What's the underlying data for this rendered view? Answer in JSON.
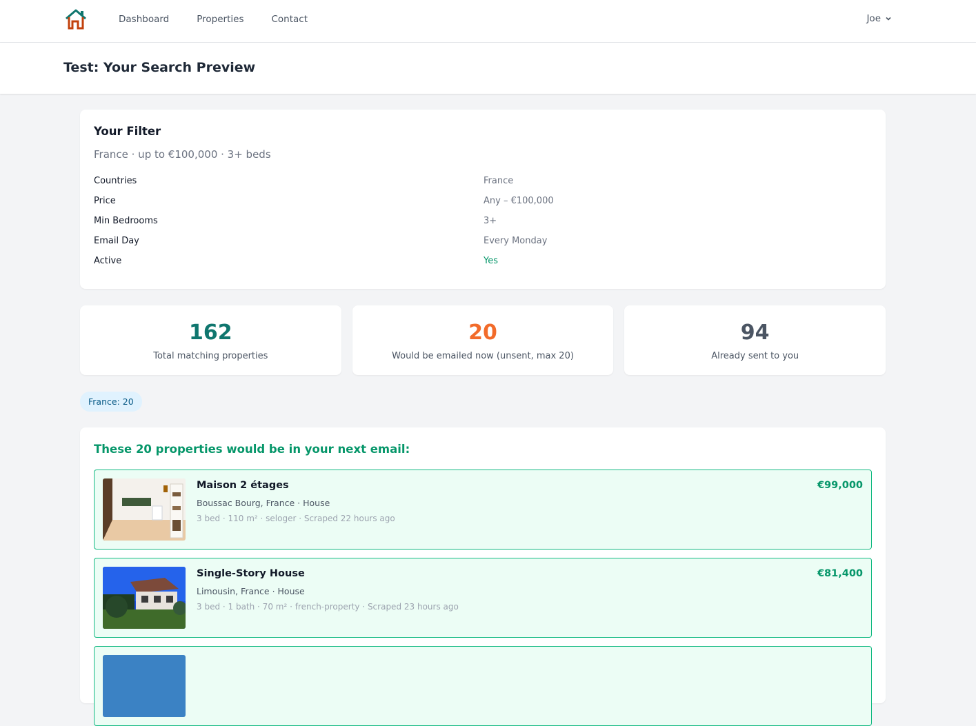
{
  "nav": {
    "logo": "house-logo",
    "links": [
      "Dashboard",
      "Properties",
      "Contact"
    ],
    "user": "Joe"
  },
  "page": {
    "title": "Test: Your Search Preview"
  },
  "filter": {
    "title": "Your Filter",
    "summary": "France · up to €100,000 · 3+ beds",
    "rows": [
      {
        "key": "Countries",
        "value": "France"
      },
      {
        "key": "Price",
        "value": "Any – €100,000"
      },
      {
        "key": "Min Bedrooms",
        "value": "3+"
      },
      {
        "key": "Email Day",
        "value": "Every Monday"
      },
      {
        "key": "Active",
        "value": "Yes"
      }
    ]
  },
  "stats": [
    {
      "value": "162",
      "label": "Total matching properties",
      "color": "#0f766e"
    },
    {
      "value": "20",
      "label": "Would be emailed now (unsent, max 20)",
      "color": "#f26b2a"
    },
    {
      "value": "94",
      "label": "Already sent to you",
      "color": "#4b5563"
    }
  ],
  "chip": "France: 20",
  "results": {
    "title": "These 20 properties would be in your next email:",
    "items": [
      {
        "title": "Maison 2 étages",
        "location": "Boussac Bourg, France · House",
        "meta": "3 bed · 110 m² · seloger · Scraped 22 hours ago",
        "price": "€99,000"
      },
      {
        "title": "Single-Story House",
        "location": "Limousin, France · House",
        "meta": "3 bed · 1 bath · 70 m² · french-property · Scraped 23 hours ago",
        "price": "€81,400"
      },
      {
        "title": "",
        "location": "",
        "meta": "",
        "price": ""
      }
    ]
  }
}
